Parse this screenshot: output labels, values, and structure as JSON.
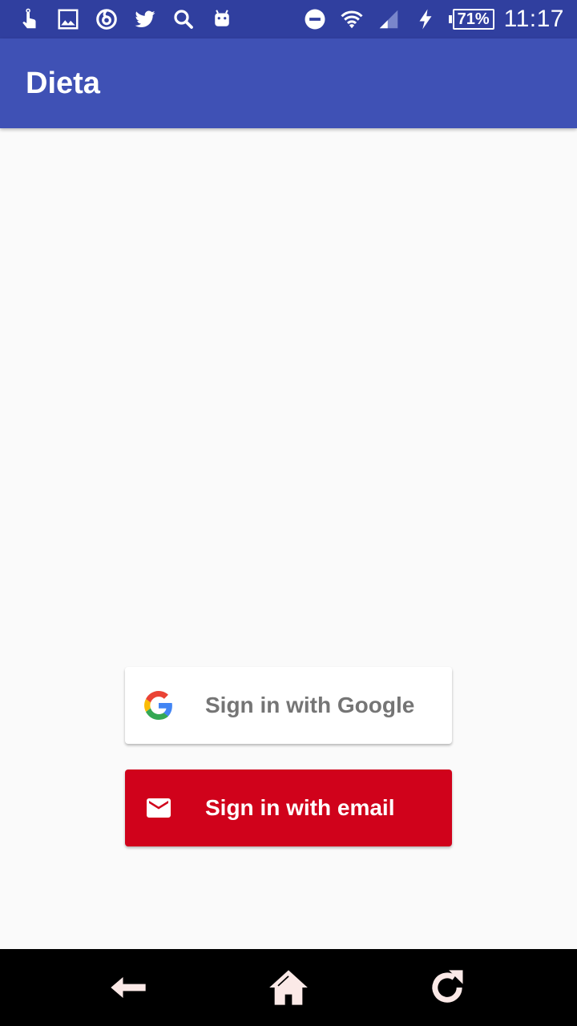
{
  "status_bar": {
    "battery": "71%",
    "time": "11:17",
    "left_icons": [
      "touch-icon",
      "image-icon",
      "threads-icon",
      "twitter-icon",
      "search-icon",
      "android-icon"
    ],
    "right_icons": [
      "do-not-disturb-icon",
      "wifi-icon",
      "signal-icon",
      "charging-icon"
    ]
  },
  "app_bar": {
    "title": "Dieta"
  },
  "sign_in": {
    "google_label": "Sign in with Google",
    "email_label": "Sign in with email"
  },
  "nav_bar": {
    "icons": [
      "back-icon",
      "home-icon",
      "recent-apps-icon"
    ]
  },
  "colors": {
    "status_bar": "#303f9f",
    "app_bar": "#3f51b5",
    "background": "#fafafa",
    "email_button": "#d0021b",
    "google_text": "#757575"
  }
}
